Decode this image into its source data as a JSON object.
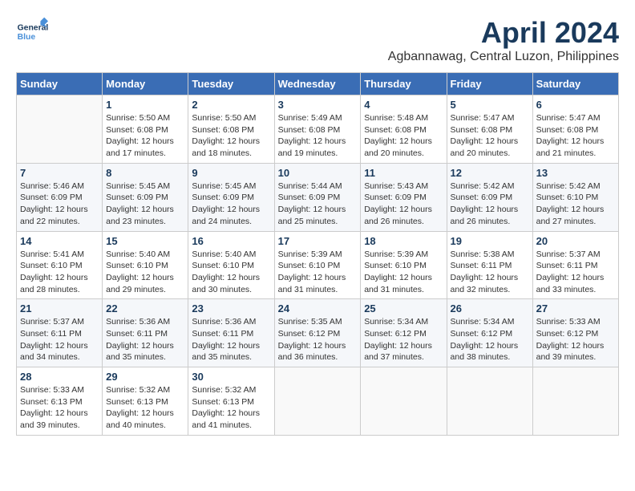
{
  "header": {
    "logo_line1": "General",
    "logo_line2": "Blue",
    "title": "April 2024",
    "subtitle": "Agbannawag, Central Luzon, Philippines"
  },
  "weekdays": [
    "Sunday",
    "Monday",
    "Tuesday",
    "Wednesday",
    "Thursday",
    "Friday",
    "Saturday"
  ],
  "weeks": [
    [
      {
        "day": "",
        "info": ""
      },
      {
        "day": "1",
        "info": "Sunrise: 5:50 AM\nSunset: 6:08 PM\nDaylight: 12 hours\nand 17 minutes."
      },
      {
        "day": "2",
        "info": "Sunrise: 5:50 AM\nSunset: 6:08 PM\nDaylight: 12 hours\nand 18 minutes."
      },
      {
        "day": "3",
        "info": "Sunrise: 5:49 AM\nSunset: 6:08 PM\nDaylight: 12 hours\nand 19 minutes."
      },
      {
        "day": "4",
        "info": "Sunrise: 5:48 AM\nSunset: 6:08 PM\nDaylight: 12 hours\nand 20 minutes."
      },
      {
        "day": "5",
        "info": "Sunrise: 5:47 AM\nSunset: 6:08 PM\nDaylight: 12 hours\nand 20 minutes."
      },
      {
        "day": "6",
        "info": "Sunrise: 5:47 AM\nSunset: 6:08 PM\nDaylight: 12 hours\nand 21 minutes."
      }
    ],
    [
      {
        "day": "7",
        "info": "Sunrise: 5:46 AM\nSunset: 6:09 PM\nDaylight: 12 hours\nand 22 minutes."
      },
      {
        "day": "8",
        "info": "Sunrise: 5:45 AM\nSunset: 6:09 PM\nDaylight: 12 hours\nand 23 minutes."
      },
      {
        "day": "9",
        "info": "Sunrise: 5:45 AM\nSunset: 6:09 PM\nDaylight: 12 hours\nand 24 minutes."
      },
      {
        "day": "10",
        "info": "Sunrise: 5:44 AM\nSunset: 6:09 PM\nDaylight: 12 hours\nand 25 minutes."
      },
      {
        "day": "11",
        "info": "Sunrise: 5:43 AM\nSunset: 6:09 PM\nDaylight: 12 hours\nand 26 minutes."
      },
      {
        "day": "12",
        "info": "Sunrise: 5:42 AM\nSunset: 6:09 PM\nDaylight: 12 hours\nand 26 minutes."
      },
      {
        "day": "13",
        "info": "Sunrise: 5:42 AM\nSunset: 6:10 PM\nDaylight: 12 hours\nand 27 minutes."
      }
    ],
    [
      {
        "day": "14",
        "info": "Sunrise: 5:41 AM\nSunset: 6:10 PM\nDaylight: 12 hours\nand 28 minutes."
      },
      {
        "day": "15",
        "info": "Sunrise: 5:40 AM\nSunset: 6:10 PM\nDaylight: 12 hours\nand 29 minutes."
      },
      {
        "day": "16",
        "info": "Sunrise: 5:40 AM\nSunset: 6:10 PM\nDaylight: 12 hours\nand 30 minutes."
      },
      {
        "day": "17",
        "info": "Sunrise: 5:39 AM\nSunset: 6:10 PM\nDaylight: 12 hours\nand 31 minutes."
      },
      {
        "day": "18",
        "info": "Sunrise: 5:39 AM\nSunset: 6:10 PM\nDaylight: 12 hours\nand 31 minutes."
      },
      {
        "day": "19",
        "info": "Sunrise: 5:38 AM\nSunset: 6:11 PM\nDaylight: 12 hours\nand 32 minutes."
      },
      {
        "day": "20",
        "info": "Sunrise: 5:37 AM\nSunset: 6:11 PM\nDaylight: 12 hours\nand 33 minutes."
      }
    ],
    [
      {
        "day": "21",
        "info": "Sunrise: 5:37 AM\nSunset: 6:11 PM\nDaylight: 12 hours\nand 34 minutes."
      },
      {
        "day": "22",
        "info": "Sunrise: 5:36 AM\nSunset: 6:11 PM\nDaylight: 12 hours\nand 35 minutes."
      },
      {
        "day": "23",
        "info": "Sunrise: 5:36 AM\nSunset: 6:11 PM\nDaylight: 12 hours\nand 35 minutes."
      },
      {
        "day": "24",
        "info": "Sunrise: 5:35 AM\nSunset: 6:12 PM\nDaylight: 12 hours\nand 36 minutes."
      },
      {
        "day": "25",
        "info": "Sunrise: 5:34 AM\nSunset: 6:12 PM\nDaylight: 12 hours\nand 37 minutes."
      },
      {
        "day": "26",
        "info": "Sunrise: 5:34 AM\nSunset: 6:12 PM\nDaylight: 12 hours\nand 38 minutes."
      },
      {
        "day": "27",
        "info": "Sunrise: 5:33 AM\nSunset: 6:12 PM\nDaylight: 12 hours\nand 39 minutes."
      }
    ],
    [
      {
        "day": "28",
        "info": "Sunrise: 5:33 AM\nSunset: 6:13 PM\nDaylight: 12 hours\nand 39 minutes."
      },
      {
        "day": "29",
        "info": "Sunrise: 5:32 AM\nSunset: 6:13 PM\nDaylight: 12 hours\nand 40 minutes."
      },
      {
        "day": "30",
        "info": "Sunrise: 5:32 AM\nSunset: 6:13 PM\nDaylight: 12 hours\nand 41 minutes."
      },
      {
        "day": "",
        "info": ""
      },
      {
        "day": "",
        "info": ""
      },
      {
        "day": "",
        "info": ""
      },
      {
        "day": "",
        "info": ""
      }
    ]
  ]
}
